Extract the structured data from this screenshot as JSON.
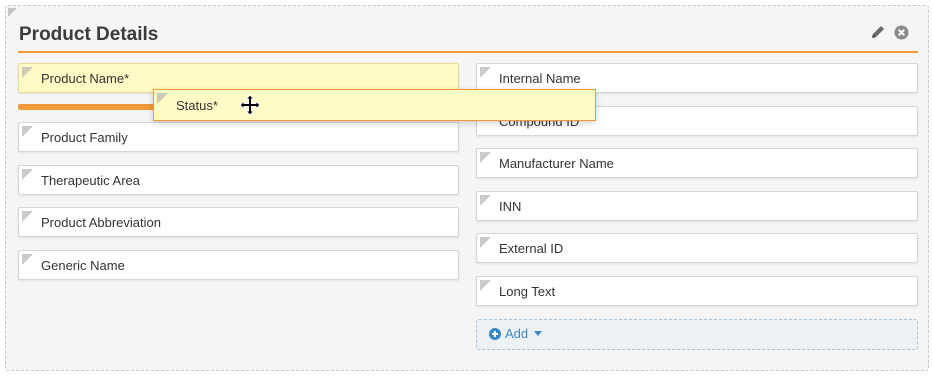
{
  "panel": {
    "title": "Product Details",
    "accent_color": "#f0993a"
  },
  "left_fields": [
    {
      "label": "Product Name*"
    },
    {
      "label": "Product Family"
    },
    {
      "label": "Therapeutic Area"
    },
    {
      "label": "Product Abbreviation"
    },
    {
      "label": "Generic Name"
    }
  ],
  "right_fields": [
    {
      "label": "Internal Name"
    },
    {
      "label": "Compound ID"
    },
    {
      "label": "Manufacturer Name"
    },
    {
      "label": "INN"
    },
    {
      "label": "External ID"
    },
    {
      "label": "Long Text"
    }
  ],
  "dragging_field": {
    "label": "Status*"
  },
  "add_button": {
    "label": "Add"
  }
}
